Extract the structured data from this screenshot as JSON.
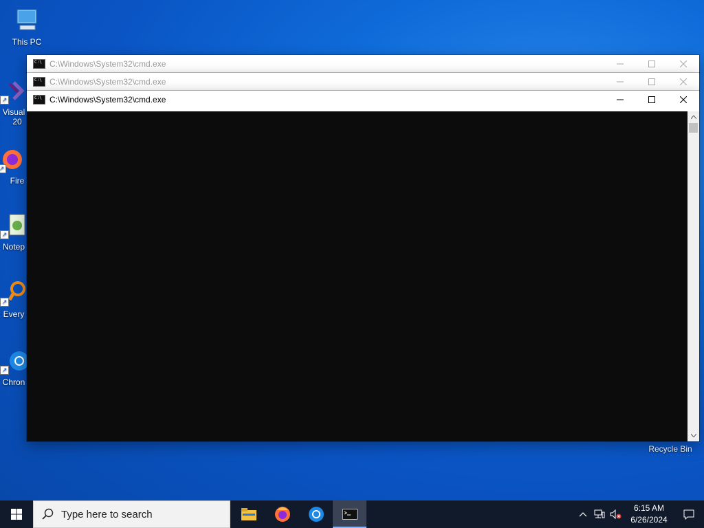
{
  "desktop": {
    "icons": [
      {
        "label": "This PC",
        "icon": "computer-icon"
      },
      {
        "label": "Visual\n20",
        "icon": "visual-studio-icon"
      },
      {
        "label": "Fire",
        "icon": "firefox-icon"
      },
      {
        "label": "Notep",
        "icon": "notepad-icon"
      },
      {
        "label": "Every",
        "icon": "everything-icon"
      },
      {
        "label": "Chron",
        "icon": "chrome-icon"
      },
      {
        "label": "Recycle Bin",
        "icon": "recycle-bin-icon"
      }
    ]
  },
  "windows": [
    {
      "title": "C:\\Windows\\System32\\cmd.exe",
      "state": "inactive"
    },
    {
      "title": "C:\\Windows\\System32\\cmd.exe",
      "state": "inactive"
    },
    {
      "title": "C:\\Windows\\System32\\cmd.exe",
      "state": "active"
    }
  ],
  "colors": {
    "console_bg": "#0c0c0c",
    "taskbar_bg": "#101a2a",
    "desktop_accent": "#0f6cd9"
  },
  "taskbar": {
    "search_placeholder": "Type here to search",
    "pinned": [
      "file-explorer-icon",
      "firefox-icon",
      "chrome-icon",
      "cmd-icon"
    ],
    "active_app": "cmd-icon",
    "clock": {
      "time": "6:15 AM",
      "date": "6/26/2024"
    }
  }
}
